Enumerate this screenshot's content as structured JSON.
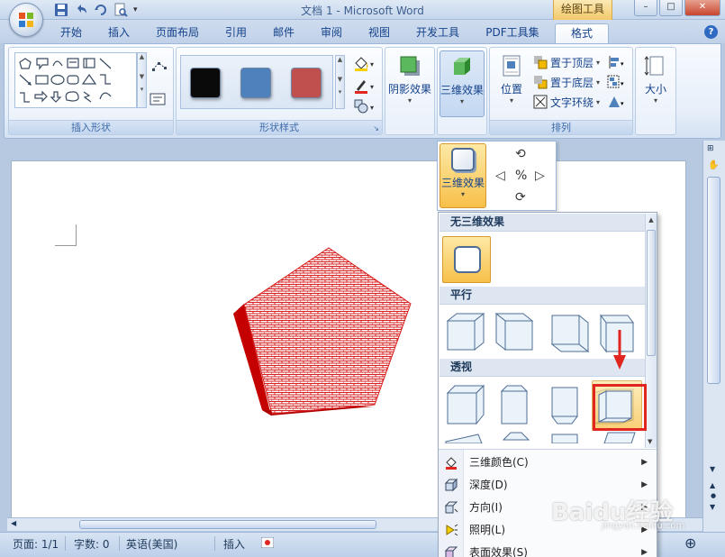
{
  "window": {
    "title": "文档 1 - Microsoft Word",
    "context_tab_title": "绘图工具",
    "controls": [
      "–",
      "□",
      "✕"
    ]
  },
  "tabs": [
    {
      "label": "开始"
    },
    {
      "label": "插入"
    },
    {
      "label": "页面布局"
    },
    {
      "label": "引用"
    },
    {
      "label": "邮件"
    },
    {
      "label": "审阅"
    },
    {
      "label": "视图"
    },
    {
      "label": "开发工具"
    },
    {
      "label": "PDF工具集"
    },
    {
      "label": "格式"
    }
  ],
  "ribbon": {
    "groups": {
      "insert_shapes": "插入形状",
      "shape_styles": "形状样式",
      "arrange": "排列"
    },
    "swatch_colors": [
      "#0a0a0a",
      "#4f81bd",
      "#c0504d"
    ],
    "shadow_effects": "阴影效果",
    "three_d_effects": "三维效果",
    "position": "位置",
    "bring_to_front": "置于顶层",
    "send_to_back": "置于底层",
    "text_wrap": "文字环绕",
    "size": "大小"
  },
  "fx_dropdown": {
    "label": "三维效果"
  },
  "gallery": {
    "sections": [
      "无三维效果",
      "平行",
      "透视"
    ],
    "menu": [
      {
        "label": "三维颜色(C)",
        "icon": "fill-color-icon"
      },
      {
        "label": "深度(D)",
        "icon": "depth-icon"
      },
      {
        "label": "方向(I)",
        "icon": "direction-icon"
      },
      {
        "label": "照明(L)",
        "icon": "lighting-icon"
      },
      {
        "label": "表面效果(S)",
        "icon": "surface-icon"
      }
    ]
  },
  "status": {
    "page": "页面: 1/1",
    "words": "字数: 0",
    "language": "英语(美国)",
    "mode": "插入"
  },
  "watermark": {
    "brand": "Baidu经验",
    "url": "jingyan.baidu.com"
  },
  "colors": {
    "pentagon_fill": "#d81e1e",
    "pentagon_side": "#c40000",
    "highlight": "#e0261e"
  }
}
